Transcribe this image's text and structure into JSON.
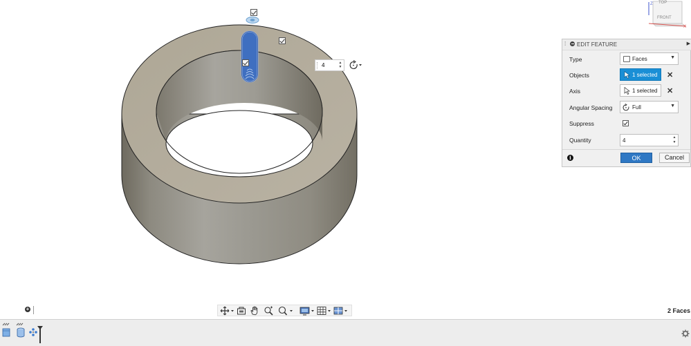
{
  "viewcube": {
    "top_label": "TOP",
    "front_label": "FRONT",
    "axis_z": "Z",
    "axis_x": "X"
  },
  "canvas": {
    "quantity_value": "4"
  },
  "panel": {
    "title": "EDIT FEATURE",
    "rows": {
      "type": {
        "label": "Type",
        "value": "Faces"
      },
      "objects": {
        "label": "Objects",
        "value": "1 selected"
      },
      "axis": {
        "label": "Axis",
        "value": "1 selected"
      },
      "angular_spacing": {
        "label": "Angular Spacing",
        "value": "Full"
      },
      "suppress": {
        "label": "Suppress",
        "checked": true
      },
      "quantity": {
        "label": "Quantity",
        "value": "4"
      }
    },
    "ok_label": "OK",
    "cancel_label": "Cancel"
  },
  "status": {
    "selection": "2 Faces"
  },
  "colors": {
    "selection_blue": "#1a8fd6",
    "ok_blue": "#2f78c4",
    "model_face": "#b3ab9c"
  }
}
